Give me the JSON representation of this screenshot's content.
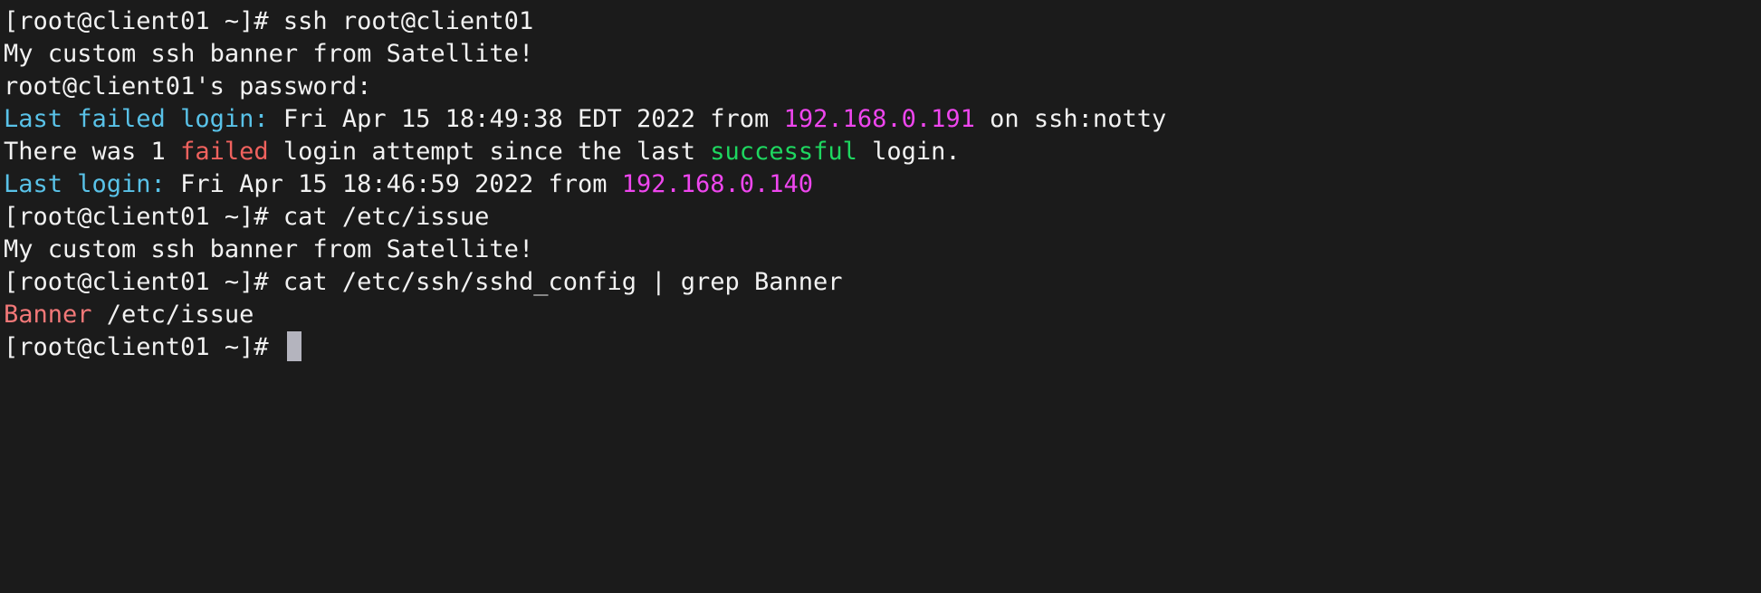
{
  "colors": {
    "background": "#1b1b1b",
    "default": "#f2f2f2",
    "cyan": "#59c2e8",
    "red": "#f0625e",
    "green": "#1ed760",
    "magenta": "#ee46ee",
    "salmon": "#f27878",
    "cursor": "#b4b4be"
  },
  "terminal": {
    "lines": [
      {
        "segments": [
          {
            "text": "[root@client01 ~]# ssh root@client01",
            "color": "default"
          }
        ]
      },
      {
        "segments": [
          {
            "text": "My custom ssh banner from Satellite!",
            "color": "default"
          }
        ]
      },
      {
        "segments": [
          {
            "text": "root@client01's password:",
            "color": "default"
          }
        ]
      },
      {
        "segments": [
          {
            "text": "Last failed login:",
            "color": "cyan"
          },
          {
            "text": " Fri Apr 15 18:49:38 EDT 2022 from ",
            "color": "default"
          },
          {
            "text": "192.168.0.191",
            "color": "magenta"
          },
          {
            "text": " on ssh:notty",
            "color": "default"
          }
        ]
      },
      {
        "segments": [
          {
            "text": "There was 1 ",
            "color": "default"
          },
          {
            "text": "failed",
            "color": "red"
          },
          {
            "text": " login attempt since the last ",
            "color": "default"
          },
          {
            "text": "successful",
            "color": "green"
          },
          {
            "text": " login.",
            "color": "default"
          }
        ]
      },
      {
        "segments": [
          {
            "text": "Last login:",
            "color": "cyan"
          },
          {
            "text": " Fri Apr 15 18:46:59 2022 from ",
            "color": "default"
          },
          {
            "text": "192.168.0.140",
            "color": "magenta"
          }
        ]
      },
      {
        "segments": [
          {
            "text": "[root@client01 ~]# cat /etc/issue",
            "color": "default"
          }
        ]
      },
      {
        "segments": [
          {
            "text": "My custom ssh banner from Satellite!",
            "color": "default"
          }
        ]
      },
      {
        "segments": [
          {
            "text": "[root@client01 ~]# cat /etc/ssh/sshd_config | grep Banner",
            "color": "default"
          }
        ]
      },
      {
        "segments": [
          {
            "text": "Banner",
            "color": "salmon"
          },
          {
            "text": " /etc/issue",
            "color": "default"
          }
        ]
      },
      {
        "segments": [
          {
            "text": "[root@client01 ~]# ",
            "color": "default"
          }
        ],
        "cursor": true
      }
    ]
  }
}
